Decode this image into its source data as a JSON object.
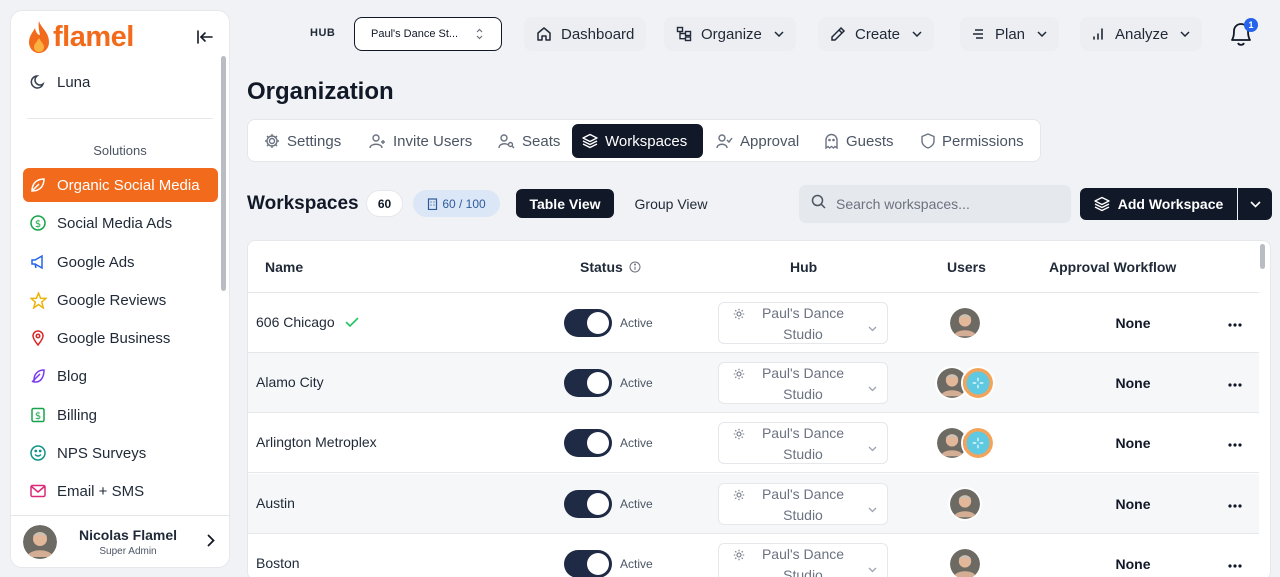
{
  "brand": {
    "name": "flamel",
    "color": "#f26b1d"
  },
  "sidebar": {
    "top_item": {
      "label": "Luna",
      "icon": "moon-icon"
    },
    "section_label": "Solutions",
    "items": [
      {
        "label": "Organic Social Media",
        "icon": "leaf-icon",
        "active": true
      },
      {
        "label": "Social Media Ads",
        "icon": "dollar-circle-icon"
      },
      {
        "label": "Google Ads",
        "icon": "megaphone-icon"
      },
      {
        "label": "Google Reviews",
        "icon": "star-icon"
      },
      {
        "label": "Google Business",
        "icon": "map-pin-icon"
      },
      {
        "label": "Blog",
        "icon": "feather-icon"
      },
      {
        "label": "Billing",
        "icon": "dollar-square-icon"
      },
      {
        "label": "NPS Surveys",
        "icon": "smile-icon"
      },
      {
        "label": "Email + SMS",
        "icon": "mail-icon"
      }
    ],
    "user": {
      "name": "Nicolas Flamel",
      "role": "Super Admin"
    }
  },
  "topnav": {
    "hub_label": "HUB",
    "hub_value": "Paul's Dance St...",
    "items": [
      {
        "label": "Dashboard",
        "icon": "home-icon",
        "has_dropdown": false
      },
      {
        "label": "Organize",
        "icon": "organize-icon",
        "has_dropdown": true
      },
      {
        "label": "Create",
        "icon": "pen-icon",
        "has_dropdown": true
      },
      {
        "label": "Plan",
        "icon": "list-icon",
        "has_dropdown": true
      },
      {
        "label": "Analyze",
        "icon": "bar-chart-icon",
        "has_dropdown": true
      }
    ],
    "notification_count": "1"
  },
  "page": {
    "title": "Organization",
    "tabs": [
      {
        "label": "Settings",
        "icon": "gear-icon"
      },
      {
        "label": "Invite Users",
        "icon": "user-plus-icon"
      },
      {
        "label": "Seats",
        "icon": "user-search-icon"
      },
      {
        "label": "Workspaces",
        "icon": "layers-icon",
        "active": true
      },
      {
        "label": "Approval",
        "icon": "user-check-icon"
      },
      {
        "label": "Guests",
        "icon": "ghost-icon"
      },
      {
        "label": "Permissions",
        "icon": "shield-icon"
      }
    ]
  },
  "workspaces": {
    "title": "Workspaces",
    "count": "60",
    "seats": "60 / 100",
    "views": [
      "Table View",
      "Group View"
    ],
    "active_view": "Table View",
    "search_placeholder": "Search workspaces...",
    "add_label": "Add Workspace"
  },
  "table": {
    "columns": [
      "Name",
      "Status",
      "Hub",
      "Users",
      "Approval Workflow"
    ],
    "rows": [
      {
        "name": "606 Chicago",
        "verified": true,
        "status": "Active",
        "hub": "Paul's Dance Studio",
        "users": 1,
        "approval": "None"
      },
      {
        "name": "Alamo City",
        "verified": false,
        "status": "Active",
        "hub": "Paul's Dance Studio",
        "users": 2,
        "approval": "None"
      },
      {
        "name": "Arlington Metroplex",
        "verified": false,
        "status": "Active",
        "hub": "Paul's Dance Studio",
        "users": 2,
        "approval": "None"
      },
      {
        "name": "Austin",
        "verified": false,
        "status": "Active",
        "hub": "Paul's Dance Studio",
        "users": 1,
        "approval": "None"
      },
      {
        "name": "Boston",
        "verified": false,
        "status": "Active",
        "hub": "Paul's Dance Studio",
        "users": 1,
        "approval": "None"
      }
    ]
  }
}
